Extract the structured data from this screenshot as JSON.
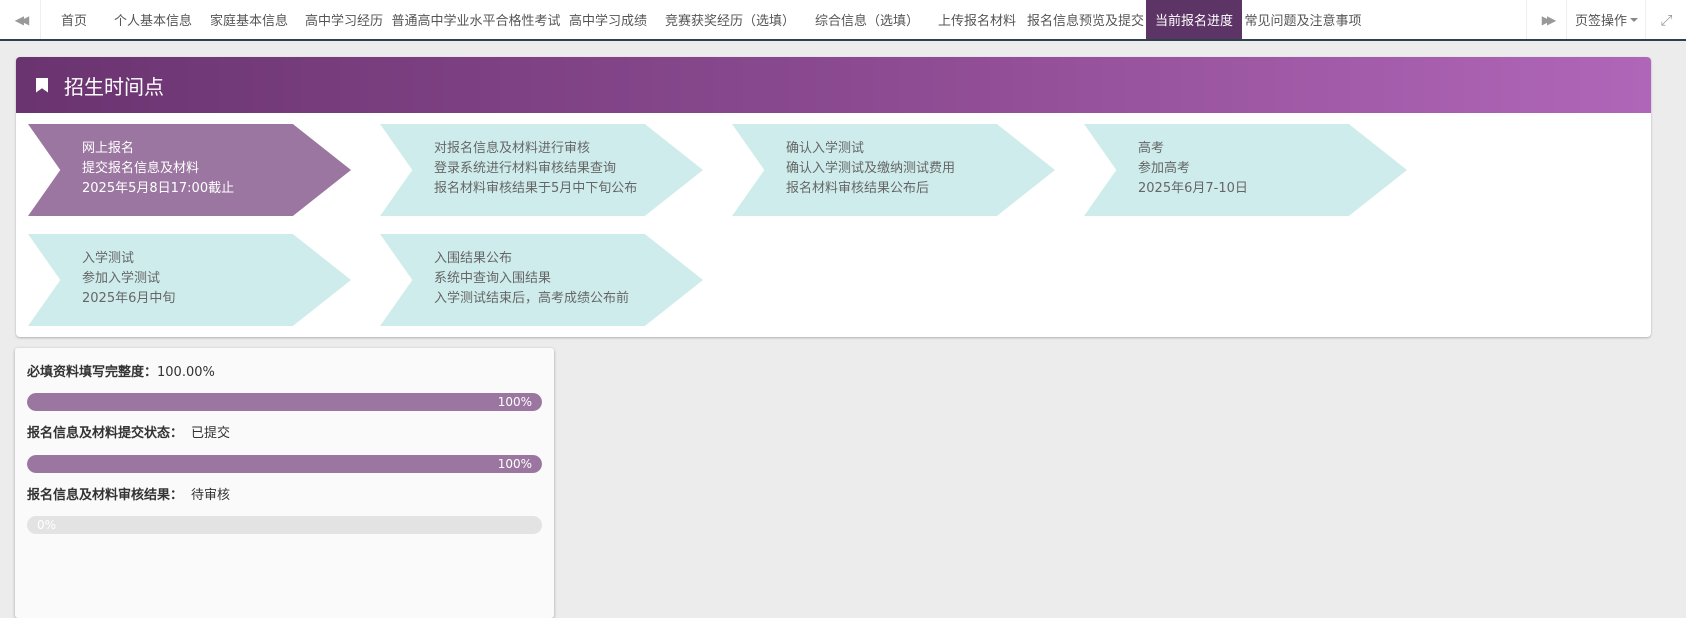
{
  "tabbar": {
    "tabs": [
      {
        "label": "首页"
      },
      {
        "label": "个人基本信息"
      },
      {
        "label": "家庭基本信息"
      },
      {
        "label": "高中学习经历"
      },
      {
        "label": "普通高中学业水平合格性考试"
      },
      {
        "label": "高中学习成绩"
      },
      {
        "label": "竞赛获奖经历（选填）"
      },
      {
        "label": "综合信息（选填）"
      },
      {
        "label": "上传报名材料"
      },
      {
        "label": "报名信息预览及提交"
      },
      {
        "label": "当前报名进度"
      },
      {
        "label": "常见问题及注意事项"
      }
    ],
    "active_index": 10,
    "tab_ops_label": "页签操作",
    "icons": {
      "left": "double-chevron-left-icon",
      "right": "double-chevron-right-icon",
      "close": "expand-icon"
    }
  },
  "timeline": {
    "title": "招生时间点",
    "steps": [
      {
        "lines": [
          "网上报名",
          "提交报名信息及材料",
          "2025年5月8日17:00截止"
        ],
        "done": true
      },
      {
        "lines": [
          "对报名信息及材料进行审核",
          "登录系统进行材料审核结果查询",
          "报名材料审核结果于5月中下旬公布"
        ],
        "done": false
      },
      {
        "lines": [
          "确认入学测试",
          "确认入学测试及缴纳测试费用",
          "报名材料审核结果公布后"
        ],
        "done": false
      },
      {
        "lines": [
          "高考",
          "参加高考",
          "2025年6月7-10日"
        ],
        "done": false
      },
      {
        "lines": [
          "入学测试",
          "参加入学测试",
          "2025年6月中旬"
        ],
        "done": false
      },
      {
        "lines": [
          "入围结果公布",
          "系统中查询入围结果",
          "入学测试结束后，高考成绩公布前"
        ],
        "done": false
      }
    ]
  },
  "progress": {
    "completeness": {
      "label": "必填资料填写完整度：",
      "value": "100.00%",
      "bar_text": "100%",
      "percent": 100
    },
    "submit_status": {
      "label": "报名信息及材料提交状态：",
      "value": "已提交",
      "bar_text": "100%",
      "percent": 100
    },
    "review_result": {
      "label": "报名信息及材料审核结果：",
      "value": "待审核",
      "bar_text": "0%",
      "percent": 0
    }
  },
  "colors": {
    "accent": "#5c3566",
    "step_done": "#9b76a0",
    "step_pending": "#cfecec",
    "bar_fill": "#9b76a0",
    "bar_track": "#e3e3e3"
  }
}
